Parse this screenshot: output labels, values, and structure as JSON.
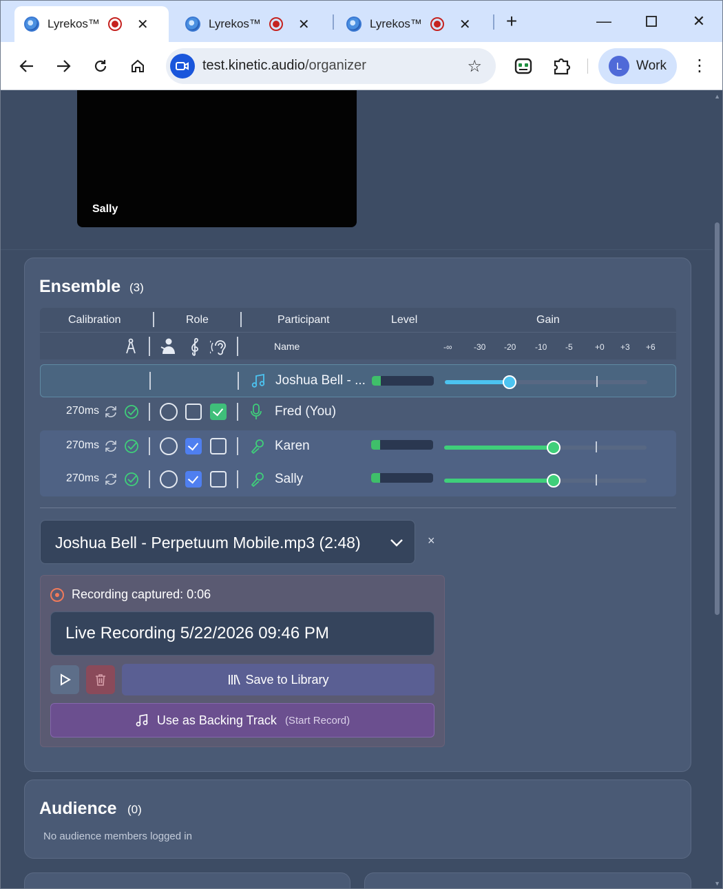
{
  "browser": {
    "tabs": [
      {
        "title": "Lyrekos™",
        "active": true
      },
      {
        "title": "Lyrekos™",
        "active": false
      },
      {
        "title": "Lyrekos™",
        "active": false
      }
    ],
    "url_host": "test.kinetic.audio",
    "url_path": "/organizer",
    "profile_initial": "L",
    "profile_label": "Work"
  },
  "video": {
    "label": "Sally"
  },
  "ensemble": {
    "title": "Ensemble",
    "count": "(3)",
    "headers": {
      "calibration": "Calibration",
      "role": "Role",
      "participant": "Participant",
      "level": "Level",
      "gain": "Gain"
    },
    "subheader_name": "Name",
    "gain_ticks": [
      "-∞",
      "-30",
      "-20",
      "-10",
      "-5",
      "+0",
      "+3",
      "+6"
    ],
    "rows": [
      {
        "latency": "",
        "name": "Joshua Bell - ...",
        "type": "track",
        "level": 0.14,
        "gain": 0.32,
        "accent": "#4cc3f0"
      },
      {
        "latency": "270ms",
        "name": "Fred (You)",
        "type": "self",
        "roles": [
          false,
          false,
          true
        ]
      },
      {
        "latency": "270ms",
        "name": "Karen",
        "type": "remote",
        "roles": [
          false,
          true,
          false
        ],
        "level": 0.14,
        "gain": 0.54,
        "accent": "#3fcf7a"
      },
      {
        "latency": "270ms",
        "name": "Sally",
        "type": "remote",
        "roles": [
          false,
          true,
          false
        ],
        "level": 0.14,
        "gain": 0.54,
        "accent": "#3fcf7a"
      }
    ],
    "track_select": "Joshua Bell - Perpetuum Mobile.mp3 (2:48)",
    "track_clear": "×",
    "recording": {
      "status": "Recording captured: 0:06",
      "name": "Live Recording 5/22/2026 09:46 PM",
      "save_label": "Save to Library",
      "use_label": "Use as Backing Track",
      "use_sub": "(Start Record)"
    }
  },
  "audience": {
    "title": "Audience",
    "count": "(0)",
    "empty": "No audience members logged in"
  }
}
